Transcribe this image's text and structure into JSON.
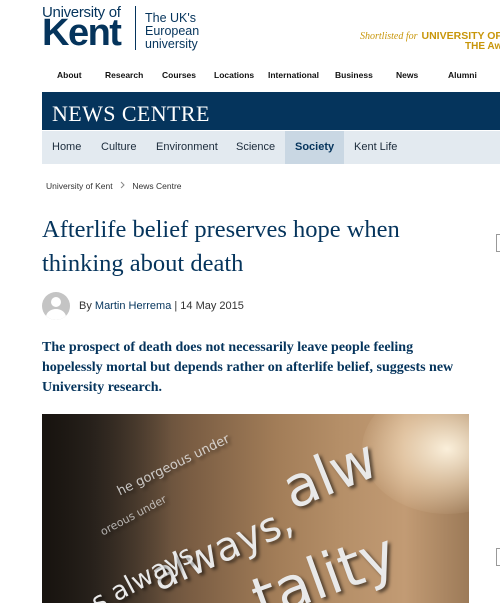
{
  "header": {
    "university_line": "University of",
    "kent": "Kent",
    "tagline": "The UK's European university",
    "shortlist_prefix": "Shortlisted for",
    "shortlist_title": "UNIVERSITY OF T",
    "shortlist_line2": "THE Aw"
  },
  "top_nav": [
    "About",
    "Research",
    "Courses",
    "Locations",
    "International",
    "Business",
    "News",
    "Alumni"
  ],
  "news_centre": {
    "title": "NEWS CENTRE"
  },
  "sub_nav": {
    "items": [
      "Home",
      "Culture",
      "Environment",
      "Science",
      "Society",
      "Kent Life"
    ],
    "active": "Society"
  },
  "breadcrumb": {
    "items": [
      "University of Kent",
      "News Centre"
    ]
  },
  "article": {
    "headline": "Afterlife belief preserves hope when thinking about death",
    "by_label": "By",
    "author": "Martin Herrema",
    "date_separator": "|",
    "date": "14 May 2015",
    "standfirst": "The prospect of death does not necessarily leave people feeling hopelessly mortal but depends rather on afterlife belief, suggests new University research.",
    "image_words": [
      "always,",
      "alw",
      "tality",
      "s always",
      "he gorgeous under",
      "oreous under"
    ]
  },
  "colors": {
    "brand_navy": "#05345c",
    "subnav_bg": "#e3eaf0",
    "subnav_active": "#c9d7e3",
    "shortlist_gold": "#c8960a"
  },
  "icons": [
    "avatar-placeholder-icon",
    "chevron-right-icon"
  ]
}
